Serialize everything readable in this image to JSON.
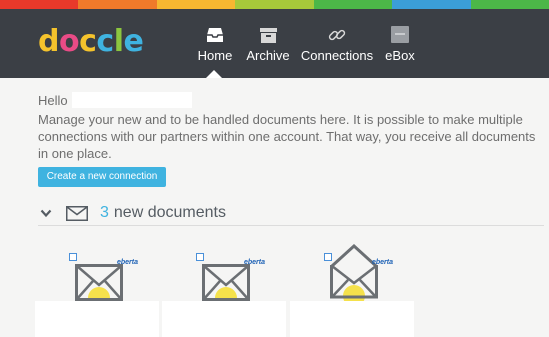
{
  "rainbow_colors": [
    "#e8392a",
    "#f07a2a",
    "#f7b731",
    "#a7c93a",
    "#4cb748",
    "#3b9ed8",
    "#4cb748"
  ],
  "logo": {
    "letters": [
      "d",
      "o",
      "c",
      "c",
      "l",
      "e"
    ],
    "colors": [
      "#f5c32c",
      "#e94b86",
      "#f5c32c",
      "#3fb3e0",
      "#8cc63f",
      "#3fb3e0"
    ]
  },
  "nav": {
    "home": {
      "label": "Home",
      "icon": "inbox-icon"
    },
    "archive": {
      "label": "Archive",
      "icon": "archive-box-icon"
    },
    "connections": {
      "label": "Connections",
      "icon": "link-icon"
    },
    "ebox": {
      "label": "eBox",
      "icon": "ebox-icon"
    }
  },
  "greeting": "Hello",
  "intro": "Manage your new and to be handled documents here. It is possible to make multiple connections with our partners within one account. That way, you receive all documents in one place.",
  "create_button": "Create a new connection",
  "documents": {
    "count": "3",
    "label": "new documents"
  },
  "cards": [
    {
      "brand": "eberta",
      "state": "closed"
    },
    {
      "brand": "eberta",
      "state": "closed"
    },
    {
      "brand": "eberta",
      "state": "open"
    }
  ],
  "colors": {
    "accent": "#3fb3e0",
    "topbar": "#3b3f45",
    "body_text": "#6e6e6e",
    "content_bg": "#f5f5f4"
  }
}
